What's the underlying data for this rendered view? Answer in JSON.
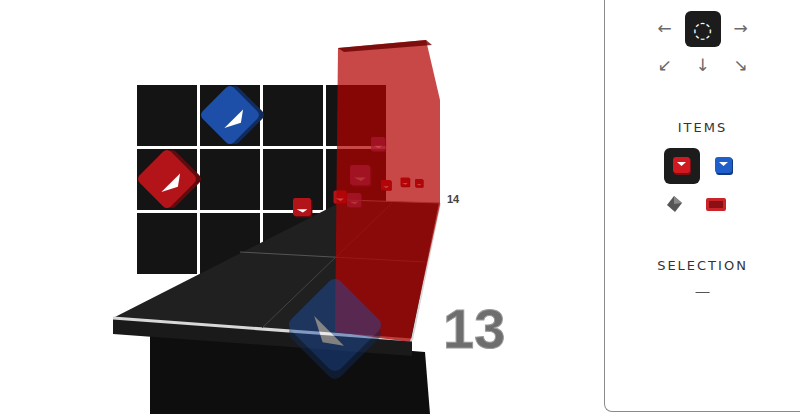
{
  "viewport": {
    "grid_notes": [
      {
        "color": "#b3141a",
        "column": 0,
        "row": 1
      },
      {
        "color": "#1d4fa8",
        "column": 1,
        "row": 0
      }
    ],
    "track_notes": [
      {
        "color": "#b3141a"
      },
      {
        "color": "#b3141a"
      },
      {
        "color": "#b3141a"
      },
      {
        "color": "#b3141a"
      },
      {
        "color": "#b3141a"
      },
      {
        "color": "#9a5aa8"
      },
      {
        "color": "#9a5aa8"
      },
      {
        "color": "#9a5aa8"
      }
    ],
    "ghost_note": {
      "color": "#1d4fa8"
    },
    "wall": {
      "color": "#b30000"
    },
    "beat_labels": [
      {
        "text": "14"
      },
      {
        "text": "13"
      }
    ]
  },
  "direction_picker": [
    {
      "glyph": "←",
      "selected": false
    },
    {
      "glyph": "◌",
      "selected": true
    },
    {
      "glyph": "→",
      "selected": false
    },
    {
      "glyph": "↙",
      "selected": false
    },
    {
      "glyph": "↓",
      "selected": false
    },
    {
      "glyph": "↘",
      "selected": false
    }
  ],
  "items": {
    "title": "ITEMS",
    "options": [
      {
        "kind": "red-block",
        "selected": true
      },
      {
        "kind": "blue-block",
        "selected": false
      },
      {
        "kind": "bomb",
        "selected": false
      },
      {
        "kind": "wall",
        "selected": false
      }
    ]
  },
  "selection": {
    "title": "SELECTION",
    "value": "—"
  }
}
